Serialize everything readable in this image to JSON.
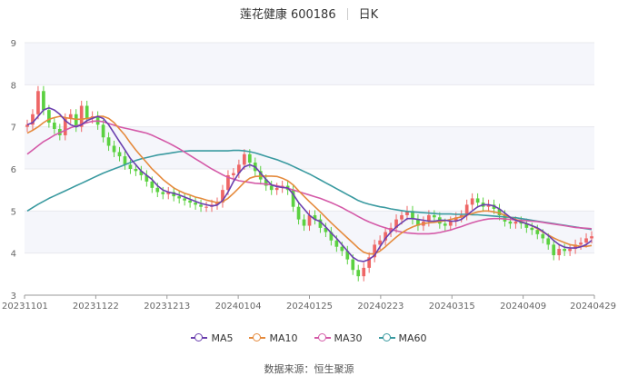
{
  "header": {
    "name": "莲花健康 600186",
    "period": "日K"
  },
  "source": "数据来源：恒生聚源",
  "colors": {
    "up": "#ee6666",
    "down": "#5bd141",
    "grid_band": "#f5f6fb",
    "axis_text": "#666666"
  },
  "legend": [
    {
      "label": "MA5",
      "color": "#6a3fae"
    },
    {
      "label": "MA10",
      "color": "#e58a3c"
    },
    {
      "label": "MA30",
      "color": "#d45aa8"
    },
    {
      "label": "MA60",
      "color": "#3a9aa0"
    }
  ],
  "chart_data": {
    "type": "candlestick",
    "ylim": [
      3,
      9
    ],
    "y_ticks": [
      3,
      4,
      5,
      6,
      7,
      8,
      9
    ],
    "x_tick_labels": [
      "20231101",
      "20231122",
      "20231213",
      "20240104",
      "20240125",
      "20240223",
      "20240315",
      "20240409",
      "20240429"
    ],
    "grid": true,
    "legend_position": "bottom",
    "closes": [
      7.05,
      7.3,
      7.85,
      7.4,
      7.1,
      6.95,
      6.8,
      7.2,
      7.3,
      7.0,
      7.5,
      7.2,
      7.25,
      7.05,
      6.75,
      6.55,
      6.4,
      6.3,
      6.1,
      6.0,
      5.95,
      5.85,
      5.7,
      5.55,
      5.45,
      5.4,
      5.45,
      5.35,
      5.3,
      5.25,
      5.2,
      5.15,
      5.1,
      5.1,
      5.15,
      5.2,
      5.5,
      5.85,
      5.9,
      6.1,
      6.35,
      6.15,
      5.95,
      5.75,
      5.6,
      5.5,
      5.55,
      5.6,
      5.5,
      5.1,
      4.8,
      4.65,
      4.9,
      4.8,
      4.6,
      4.5,
      4.3,
      4.15,
      4.05,
      3.85,
      3.6,
      3.45,
      3.65,
      3.9,
      4.2,
      4.3,
      4.5,
      4.6,
      4.8,
      4.9,
      5.0,
      4.8,
      4.65,
      4.75,
      4.9,
      4.85,
      4.7,
      4.65,
      4.75,
      4.85,
      4.9,
      5.15,
      5.3,
      5.2,
      5.1,
      5.15,
      5.05,
      4.9,
      4.75,
      4.7,
      4.75,
      4.7,
      4.6,
      4.55,
      4.45,
      4.35,
      4.2,
      3.95,
      4.1,
      4.05,
      4.1,
      4.2,
      4.25,
      4.35,
      4.4
    ],
    "opens": [
      7.0,
      7.05,
      7.3,
      7.85,
      7.4,
      7.1,
      6.95,
      6.8,
      7.2,
      7.3,
      7.0,
      7.5,
      7.2,
      7.25,
      7.05,
      6.75,
      6.55,
      6.4,
      6.3,
      6.1,
      6.0,
      5.95,
      5.85,
      5.7,
      5.55,
      5.45,
      5.4,
      5.45,
      5.35,
      5.3,
      5.25,
      5.2,
      5.15,
      5.1,
      5.1,
      5.15,
      5.2,
      5.5,
      5.85,
      5.9,
      6.1,
      6.35,
      6.15,
      5.95,
      5.75,
      5.6,
      5.5,
      5.55,
      5.6,
      5.5,
      5.1,
      4.8,
      4.65,
      4.9,
      4.8,
      4.6,
      4.5,
      4.3,
      4.15,
      4.05,
      3.85,
      3.6,
      3.45,
      3.65,
      3.9,
      4.2,
      4.3,
      4.5,
      4.6,
      4.8,
      4.9,
      5.0,
      4.8,
      4.65,
      4.75,
      4.9,
      4.85,
      4.7,
      4.65,
      4.75,
      4.85,
      4.9,
      5.15,
      5.3,
      5.2,
      5.1,
      5.15,
      5.05,
      4.9,
      4.75,
      4.7,
      4.75,
      4.7,
      4.6,
      4.55,
      4.45,
      4.35,
      4.2,
      3.95,
      4.1,
      4.05,
      4.1,
      4.2,
      4.25,
      4.35
    ],
    "ma5": [
      7.05,
      7.1,
      7.25,
      7.4,
      7.45,
      7.4,
      7.3,
      7.15,
      7.05,
      7.0,
      7.05,
      7.15,
      7.2,
      7.25,
      7.2,
      7.05,
      6.85,
      6.65,
      6.45,
      6.25,
      6.1,
      5.95,
      5.85,
      5.75,
      5.6,
      5.5,
      5.45,
      5.42,
      5.38,
      5.33,
      5.28,
      5.23,
      5.18,
      5.15,
      5.12,
      5.14,
      5.25,
      5.45,
      5.7,
      5.9,
      6.05,
      6.1,
      6.05,
      5.9,
      5.75,
      5.62,
      5.58,
      5.56,
      5.55,
      5.4,
      5.2,
      5.05,
      4.9,
      4.8,
      4.75,
      4.62,
      4.48,
      4.35,
      4.2,
      4.05,
      3.9,
      3.82,
      3.8,
      3.85,
      3.95,
      4.15,
      4.35,
      4.5,
      4.62,
      4.72,
      4.82,
      4.82,
      4.8,
      4.78,
      4.76,
      4.76,
      4.78,
      4.78,
      4.76,
      4.76,
      4.8,
      4.9,
      5.0,
      5.1,
      5.15,
      5.15,
      5.12,
      5.05,
      4.95,
      4.85,
      4.78,
      4.74,
      4.7,
      4.65,
      4.6,
      4.52,
      4.42,
      4.3,
      4.2,
      4.14,
      4.12,
      4.12,
      4.15,
      4.2,
      4.3
    ],
    "ma10": [
      6.85,
      6.92,
      7.0,
      7.1,
      7.18,
      7.22,
      7.25,
      7.22,
      7.2,
      7.18,
      7.18,
      7.2,
      7.22,
      7.25,
      7.25,
      7.2,
      7.1,
      6.95,
      6.8,
      6.62,
      6.45,
      6.3,
      6.15,
      6.0,
      5.88,
      5.75,
      5.65,
      5.55,
      5.48,
      5.42,
      5.38,
      5.33,
      5.3,
      5.26,
      5.23,
      5.2,
      5.22,
      5.3,
      5.42,
      5.55,
      5.68,
      5.78,
      5.82,
      5.83,
      5.83,
      5.83,
      5.82,
      5.78,
      5.72,
      5.62,
      5.48,
      5.35,
      5.22,
      5.1,
      4.98,
      4.85,
      4.72,
      4.6,
      4.48,
      4.36,
      4.24,
      4.12,
      4.02,
      3.98,
      3.98,
      4.05,
      4.15,
      4.27,
      4.38,
      4.48,
      4.56,
      4.62,
      4.67,
      4.7,
      4.72,
      4.73,
      4.75,
      4.77,
      4.8,
      4.83,
      4.86,
      4.9,
      4.94,
      4.98,
      5.0,
      5.0,
      4.98,
      4.95,
      4.9,
      4.85,
      4.8,
      4.75,
      4.7,
      4.65,
      4.58,
      4.5,
      4.43,
      4.36,
      4.3,
      4.25,
      4.2,
      4.18,
      4.16,
      4.16,
      4.18
    ],
    "ma30": [
      6.35,
      6.45,
      6.55,
      6.65,
      6.72,
      6.8,
      6.86,
      6.92,
      6.98,
      7.02,
      7.06,
      7.1,
      7.13,
      7.14,
      7.12,
      7.08,
      7.04,
      7.0,
      6.97,
      6.94,
      6.91,
      6.88,
      6.85,
      6.8,
      6.74,
      6.68,
      6.62,
      6.55,
      6.48,
      6.4,
      6.32,
      6.24,
      6.16,
      6.08,
      6.0,
      5.93,
      5.86,
      5.8,
      5.76,
      5.72,
      5.7,
      5.68,
      5.66,
      5.65,
      5.64,
      5.62,
      5.6,
      5.57,
      5.54,
      5.5,
      5.46,
      5.42,
      5.38,
      5.34,
      5.3,
      5.25,
      5.2,
      5.14,
      5.08,
      5.01,
      4.94,
      4.87,
      4.8,
      4.74,
      4.69,
      4.64,
      4.6,
      4.56,
      4.53,
      4.5,
      4.48,
      4.47,
      4.46,
      4.46,
      4.46,
      4.47,
      4.49,
      4.52,
      4.55,
      4.59,
      4.63,
      4.68,
      4.72,
      4.76,
      4.79,
      4.81,
      4.82,
      4.82,
      4.81,
      4.8,
      4.79,
      4.78,
      4.77,
      4.76,
      4.75,
      4.73,
      4.71,
      4.69,
      4.67,
      4.65,
      4.63,
      4.61,
      4.6,
      4.59,
      4.58
    ],
    "ma60": [
      5.0,
      5.08,
      5.16,
      5.23,
      5.3,
      5.36,
      5.42,
      5.48,
      5.54,
      5.6,
      5.66,
      5.72,
      5.78,
      5.84,
      5.9,
      5.95,
      6.0,
      6.05,
      6.1,
      6.15,
      6.2,
      6.24,
      6.27,
      6.3,
      6.33,
      6.35,
      6.37,
      6.39,
      6.41,
      6.42,
      6.43,
      6.43,
      6.43,
      6.43,
      6.43,
      6.43,
      6.43,
      6.43,
      6.44,
      6.44,
      6.43,
      6.41,
      6.38,
      6.34,
      6.3,
      6.26,
      6.22,
      6.17,
      6.12,
      6.06,
      6.0,
      5.94,
      5.88,
      5.81,
      5.74,
      5.67,
      5.6,
      5.53,
      5.46,
      5.39,
      5.32,
      5.25,
      5.2,
      5.16,
      5.13,
      5.1,
      5.08,
      5.05,
      5.03,
      5.01,
      4.99,
      4.98,
      4.97,
      4.96,
      4.95,
      4.94,
      4.93,
      4.93,
      4.93,
      4.92,
      4.92,
      4.92,
      4.91,
      4.91,
      4.9,
      4.89,
      4.88,
      4.87,
      4.86,
      4.85,
      4.84,
      4.82,
      4.8,
      4.78,
      4.76,
      4.74,
      4.72,
      4.7,
      4.68,
      4.66,
      4.64,
      4.62,
      4.6,
      4.58,
      4.56
    ]
  }
}
